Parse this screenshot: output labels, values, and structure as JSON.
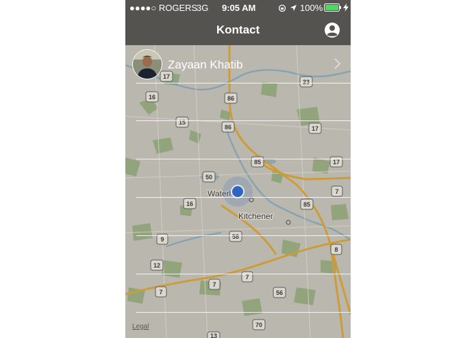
{
  "status_bar": {
    "carrier": "●●●●○ ROGERS",
    "network": "3G",
    "time": "9:05 AM",
    "battery": "100%",
    "battery_level": 1.0
  },
  "nav": {
    "title": "Kontact",
    "profile_icon": "user-circle-icon"
  },
  "contacts": [
    {
      "name": "Zayaan Khatib",
      "chevron_icon": "chevron-right-icon"
    }
  ],
  "map": {
    "place_labels": [
      "Waterloo",
      "Kitchener"
    ],
    "highway_shields": [
      "17",
      "23",
      "16",
      "86",
      "86",
      "15",
      "17",
      "85",
      "17",
      "50",
      "7",
      "16",
      "85",
      "58",
      "9",
      "8",
      "12",
      "7",
      "7",
      "7",
      "56",
      "70",
      "13"
    ],
    "legal_link": "Legal",
    "colors": {
      "land": "#cfcdc4",
      "park": "#8fae76",
      "water": "#7fa7c1",
      "highway": "#e0a52c",
      "location_dot": "#1b62d6"
    }
  }
}
